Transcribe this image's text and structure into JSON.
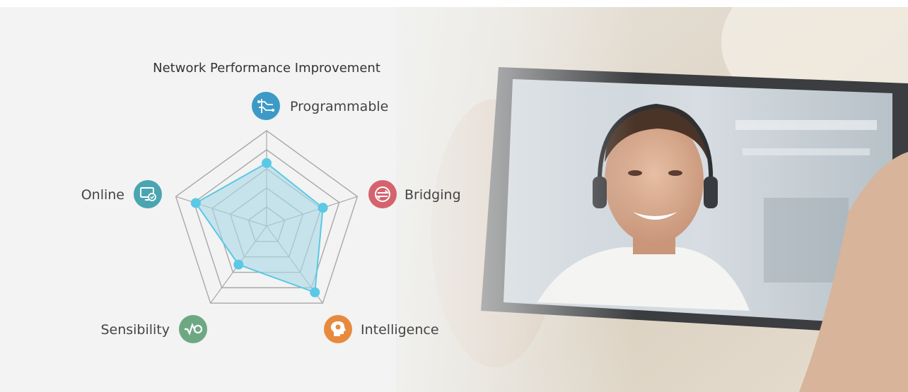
{
  "chart_data": {
    "type": "radar",
    "title": "Network Performance Improvement",
    "axes": [
      "Programmable",
      "Bridging",
      "Intelligence",
      "Sensibility",
      "Online"
    ],
    "scale_max": 5,
    "grid_levels": 5,
    "values": [
      3.3,
      3.1,
      4.3,
      2.5,
      3.9
    ],
    "series_color": "#5bc8e6",
    "fill_color": "#a9d8e6"
  },
  "axis_icons": [
    {
      "axis": "Programmable",
      "icon": "circuit-icon",
      "color": "#3d9ac7"
    },
    {
      "axis": "Bridging",
      "icon": "arrows-exchange-icon",
      "color": "#d4636d"
    },
    {
      "axis": "Intelligence",
      "icon": "head-brain-icon",
      "color": "#e88a3e"
    },
    {
      "axis": "Sensibility",
      "icon": "signal-pulse-icon",
      "color": "#6ea883"
    },
    {
      "axis": "Online",
      "icon": "monitor-check-icon",
      "color": "#4aa5b0"
    }
  ]
}
